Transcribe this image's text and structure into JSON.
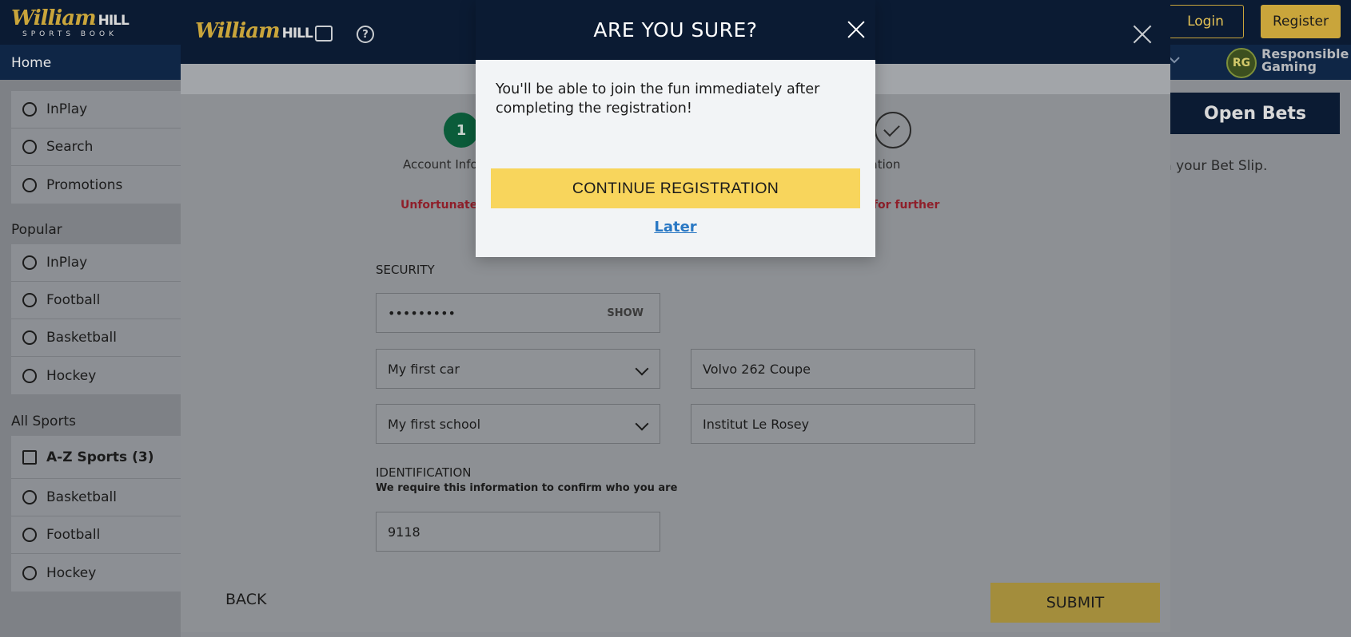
{
  "site": {
    "logo_main": "William",
    "logo_hill": "HILL",
    "logo_sub": "SPORTS BOOK",
    "login_label": "Login",
    "register_label": "Register",
    "nav_home": "Home",
    "rg_badge": "RG",
    "rg_line1": "Responsible",
    "rg_line2": "Gaming"
  },
  "sidebar": {
    "top_items": [
      {
        "label": "InPlay",
        "icon": "stopwatch-icon"
      },
      {
        "label": "Search",
        "icon": "search-icon"
      },
      {
        "label": "Promotions",
        "icon": "promotions-icon"
      }
    ],
    "popular_heading": "Popular",
    "popular_items": [
      {
        "label": "InPlay",
        "icon": "stopwatch-icon"
      },
      {
        "label": "Football",
        "icon": "football-icon"
      },
      {
        "label": "Basketball",
        "icon": "basketball-icon"
      },
      {
        "label": "Hockey",
        "icon": "hockey-icon"
      }
    ],
    "all_sports_heading": "All Sports",
    "az_label": "A-Z Sports (3)",
    "az_items": [
      {
        "label": "Basketball",
        "icon": "basketball-icon"
      },
      {
        "label": "Football",
        "icon": "football-icon"
      },
      {
        "label": "Hockey",
        "icon": "hockey-icon"
      }
    ]
  },
  "betslip": {
    "open_bets": "Open Bets",
    "text": "g in your Bet Slip."
  },
  "registration": {
    "step1_number": "1",
    "step1_label": "Account Info",
    "step3_label": "rmation",
    "error_left": "Unfortunatel",
    "error_right": "ail for further",
    "security_heading": "SECURITY",
    "password_value": "•••••••••",
    "show_label": "SHOW",
    "question1": "My first car",
    "answer1": "Volvo 262 Coupe",
    "question2": "My first school",
    "answer2": "Institut Le Rosey",
    "identification_heading": "IDENTIFICATION",
    "identification_sub": "We require this information to confirm who you are",
    "id_value": "9118",
    "back_label": "BACK",
    "submit_label": "SUBMIT"
  },
  "dialog": {
    "title": "ARE YOU SURE?",
    "message": "You'll be able to join the fun immediately after completing the registration!",
    "continue_label": "CONTINUE REGISTRATION",
    "later_label": "Later"
  }
}
